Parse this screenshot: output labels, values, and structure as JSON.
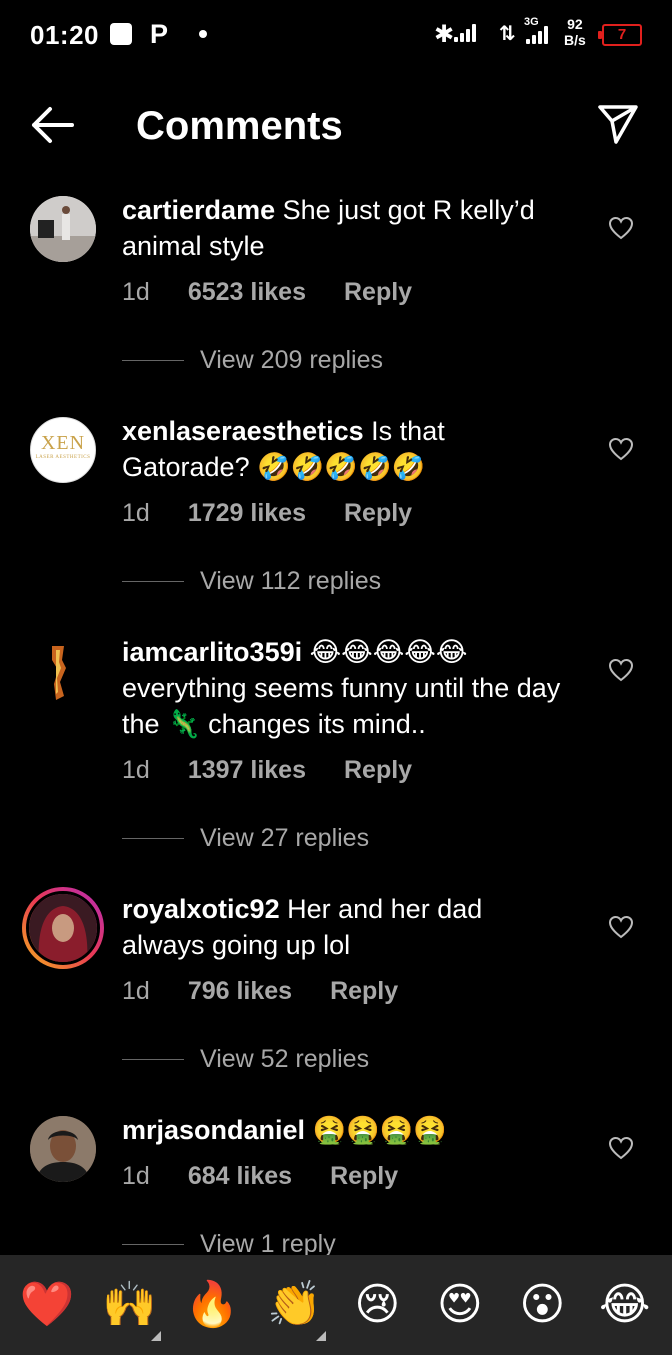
{
  "status_bar": {
    "time": "01:20",
    "p_icon": "P",
    "network": "3G",
    "speed_value": "92",
    "speed_unit": "B/s",
    "battery": "7"
  },
  "header": {
    "title": "Comments"
  },
  "comments": [
    {
      "username": "cartierdame",
      "text": "She just got R kelly’d animal style",
      "time": "1d",
      "likes": "6523 likes",
      "reply": "Reply",
      "view_replies": "View 209 replies"
    },
    {
      "username": "xenlaseraesthetics",
      "text": "Is that Gatorade? 🤣🤣🤣🤣🤣",
      "time": "1d",
      "likes": "1729 likes",
      "reply": "Reply",
      "view_replies": "View 112 replies",
      "avatar_text": "XEN",
      "avatar_subtext": "LASER AESTHETICS"
    },
    {
      "username": "iamcarlito359i",
      "text": "😂😂😂😂😂 everything seems funny until the day the 🦎 changes its mind..",
      "time": "1d",
      "likes": "1397 likes",
      "reply": "Reply",
      "view_replies": "View 27 replies"
    },
    {
      "username": "royalxotic92",
      "text": "Her and her dad always going up lol",
      "time": "1d",
      "likes": "796 likes",
      "reply": "Reply",
      "view_replies": "View 52 replies"
    },
    {
      "username": "mrjasondaniel",
      "text": "🤮🤮🤮🤮",
      "time": "1d",
      "likes": "684 likes",
      "reply": "Reply",
      "view_replies": "View 1 reply"
    }
  ],
  "emoji_bar": [
    "❤️",
    "🙌",
    "🔥",
    "👏",
    "😢",
    "😍",
    "😮",
    "😂"
  ]
}
